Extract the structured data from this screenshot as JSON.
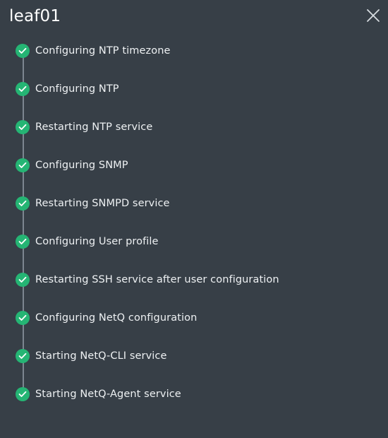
{
  "window": {
    "title": "leaf01"
  },
  "colors": {
    "background": "#373f47",
    "success": "#25b574",
    "line": "#7d8690",
    "text": "#eef1f3"
  },
  "icons": {
    "close": "close-icon",
    "step_status": "check-circle-icon"
  },
  "steps": [
    {
      "label": "Configuring NTP timezone",
      "status": "complete"
    },
    {
      "label": "Configuring NTP",
      "status": "complete"
    },
    {
      "label": "Restarting NTP service",
      "status": "complete"
    },
    {
      "label": "Configuring SNMP",
      "status": "complete"
    },
    {
      "label": "Restarting SNMPD service",
      "status": "complete"
    },
    {
      "label": "Configuring User profile",
      "status": "complete"
    },
    {
      "label": "Restarting SSH service after user configuration",
      "status": "complete"
    },
    {
      "label": "Configuring NetQ configuration",
      "status": "complete"
    },
    {
      "label": "Starting NetQ-CLI service",
      "status": "complete"
    },
    {
      "label": "Starting NetQ-Agent service",
      "status": "complete"
    }
  ]
}
